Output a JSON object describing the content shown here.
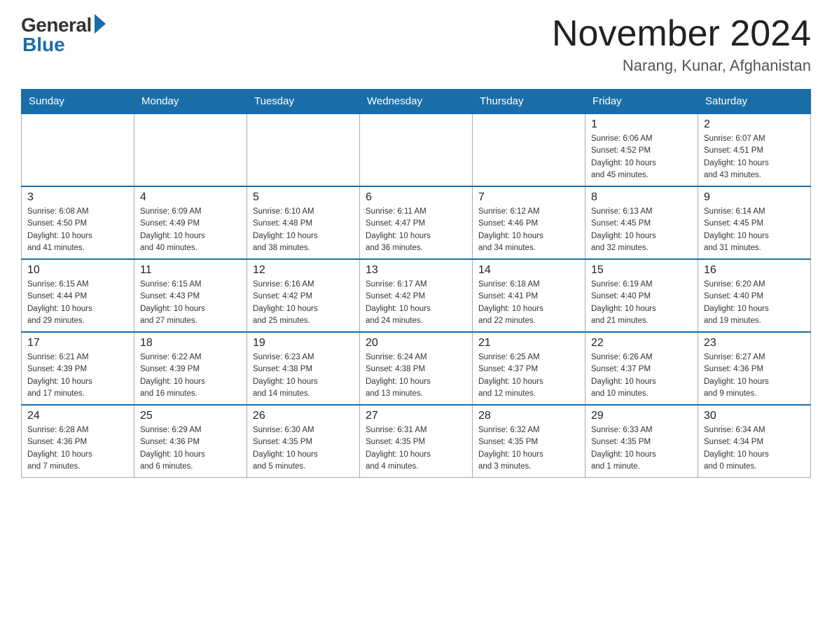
{
  "logo": {
    "general": "General",
    "blue": "Blue"
  },
  "title": "November 2024",
  "location": "Narang, Kunar, Afghanistan",
  "days_of_week": [
    "Sunday",
    "Monday",
    "Tuesday",
    "Wednesday",
    "Thursday",
    "Friday",
    "Saturday"
  ],
  "weeks": [
    [
      {
        "day": "",
        "info": ""
      },
      {
        "day": "",
        "info": ""
      },
      {
        "day": "",
        "info": ""
      },
      {
        "day": "",
        "info": ""
      },
      {
        "day": "",
        "info": ""
      },
      {
        "day": "1",
        "info": "Sunrise: 6:06 AM\nSunset: 4:52 PM\nDaylight: 10 hours\nand 45 minutes."
      },
      {
        "day": "2",
        "info": "Sunrise: 6:07 AM\nSunset: 4:51 PM\nDaylight: 10 hours\nand 43 minutes."
      }
    ],
    [
      {
        "day": "3",
        "info": "Sunrise: 6:08 AM\nSunset: 4:50 PM\nDaylight: 10 hours\nand 41 minutes."
      },
      {
        "day": "4",
        "info": "Sunrise: 6:09 AM\nSunset: 4:49 PM\nDaylight: 10 hours\nand 40 minutes."
      },
      {
        "day": "5",
        "info": "Sunrise: 6:10 AM\nSunset: 4:48 PM\nDaylight: 10 hours\nand 38 minutes."
      },
      {
        "day": "6",
        "info": "Sunrise: 6:11 AM\nSunset: 4:47 PM\nDaylight: 10 hours\nand 36 minutes."
      },
      {
        "day": "7",
        "info": "Sunrise: 6:12 AM\nSunset: 4:46 PM\nDaylight: 10 hours\nand 34 minutes."
      },
      {
        "day": "8",
        "info": "Sunrise: 6:13 AM\nSunset: 4:45 PM\nDaylight: 10 hours\nand 32 minutes."
      },
      {
        "day": "9",
        "info": "Sunrise: 6:14 AM\nSunset: 4:45 PM\nDaylight: 10 hours\nand 31 minutes."
      }
    ],
    [
      {
        "day": "10",
        "info": "Sunrise: 6:15 AM\nSunset: 4:44 PM\nDaylight: 10 hours\nand 29 minutes."
      },
      {
        "day": "11",
        "info": "Sunrise: 6:15 AM\nSunset: 4:43 PM\nDaylight: 10 hours\nand 27 minutes."
      },
      {
        "day": "12",
        "info": "Sunrise: 6:16 AM\nSunset: 4:42 PM\nDaylight: 10 hours\nand 25 minutes."
      },
      {
        "day": "13",
        "info": "Sunrise: 6:17 AM\nSunset: 4:42 PM\nDaylight: 10 hours\nand 24 minutes."
      },
      {
        "day": "14",
        "info": "Sunrise: 6:18 AM\nSunset: 4:41 PM\nDaylight: 10 hours\nand 22 minutes."
      },
      {
        "day": "15",
        "info": "Sunrise: 6:19 AM\nSunset: 4:40 PM\nDaylight: 10 hours\nand 21 minutes."
      },
      {
        "day": "16",
        "info": "Sunrise: 6:20 AM\nSunset: 4:40 PM\nDaylight: 10 hours\nand 19 minutes."
      }
    ],
    [
      {
        "day": "17",
        "info": "Sunrise: 6:21 AM\nSunset: 4:39 PM\nDaylight: 10 hours\nand 17 minutes."
      },
      {
        "day": "18",
        "info": "Sunrise: 6:22 AM\nSunset: 4:39 PM\nDaylight: 10 hours\nand 16 minutes."
      },
      {
        "day": "19",
        "info": "Sunrise: 6:23 AM\nSunset: 4:38 PM\nDaylight: 10 hours\nand 14 minutes."
      },
      {
        "day": "20",
        "info": "Sunrise: 6:24 AM\nSunset: 4:38 PM\nDaylight: 10 hours\nand 13 minutes."
      },
      {
        "day": "21",
        "info": "Sunrise: 6:25 AM\nSunset: 4:37 PM\nDaylight: 10 hours\nand 12 minutes."
      },
      {
        "day": "22",
        "info": "Sunrise: 6:26 AM\nSunset: 4:37 PM\nDaylight: 10 hours\nand 10 minutes."
      },
      {
        "day": "23",
        "info": "Sunrise: 6:27 AM\nSunset: 4:36 PM\nDaylight: 10 hours\nand 9 minutes."
      }
    ],
    [
      {
        "day": "24",
        "info": "Sunrise: 6:28 AM\nSunset: 4:36 PM\nDaylight: 10 hours\nand 7 minutes."
      },
      {
        "day": "25",
        "info": "Sunrise: 6:29 AM\nSunset: 4:36 PM\nDaylight: 10 hours\nand 6 minutes."
      },
      {
        "day": "26",
        "info": "Sunrise: 6:30 AM\nSunset: 4:35 PM\nDaylight: 10 hours\nand 5 minutes."
      },
      {
        "day": "27",
        "info": "Sunrise: 6:31 AM\nSunset: 4:35 PM\nDaylight: 10 hours\nand 4 minutes."
      },
      {
        "day": "28",
        "info": "Sunrise: 6:32 AM\nSunset: 4:35 PM\nDaylight: 10 hours\nand 3 minutes."
      },
      {
        "day": "29",
        "info": "Sunrise: 6:33 AM\nSunset: 4:35 PM\nDaylight: 10 hours\nand 1 minute."
      },
      {
        "day": "30",
        "info": "Sunrise: 6:34 AM\nSunset: 4:34 PM\nDaylight: 10 hours\nand 0 minutes."
      }
    ]
  ]
}
